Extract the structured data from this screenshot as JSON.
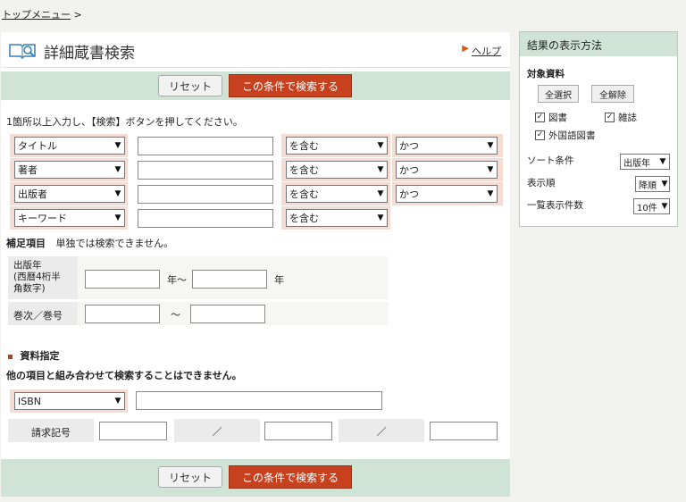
{
  "breadcrumb": {
    "link": "トップメニュー",
    "separator": ">"
  },
  "header": {
    "title": "詳細蔵書検索",
    "help_label": "ヘルプ"
  },
  "buttons": {
    "reset": "リセット",
    "search": "この条件で検索する"
  },
  "instructions": "1箇所以上入力し、【検索】ボタンを押してください。",
  "criteria_rows": [
    {
      "field": "タイトル",
      "match": "を含む",
      "connector": "かつ"
    },
    {
      "field": "著者",
      "match": "を含む",
      "connector": "かつ"
    },
    {
      "field": "出版者",
      "match": "を含む",
      "connector": "かつ"
    },
    {
      "field": "キーワード",
      "match": "を含む",
      "connector": ""
    }
  ],
  "supplementary": {
    "heading": "補足項目",
    "note": "単独では検索できません。",
    "pub_year_label": "出版年\n(西暦4桁半\n角数字)",
    "year_from_suffix": "年～",
    "year_to_suffix": "年",
    "volume_label": "巻次／巻号",
    "volume_sep": "～"
  },
  "material": {
    "heading": "資料指定",
    "note": "他の項目と組み合わせて検索することはできません。",
    "type_select": "ISBN",
    "call_number_label": "請求記号",
    "slash": "／"
  },
  "sidebar": {
    "title": "結果の表示方法",
    "target_heading": "対象資料",
    "select_all": "全選択",
    "deselect_all": "全解除",
    "checkboxes": [
      {
        "label": "図書",
        "checked": true
      },
      {
        "label": "雑誌",
        "checked": true
      },
      {
        "label": "外国語図書",
        "checked": true
      }
    ],
    "sort_label": "ソート条件",
    "sort_value": "出版年",
    "order_label": "表示順",
    "order_value": "降順",
    "count_label": "一覧表示件数",
    "count_value": "10件"
  }
}
